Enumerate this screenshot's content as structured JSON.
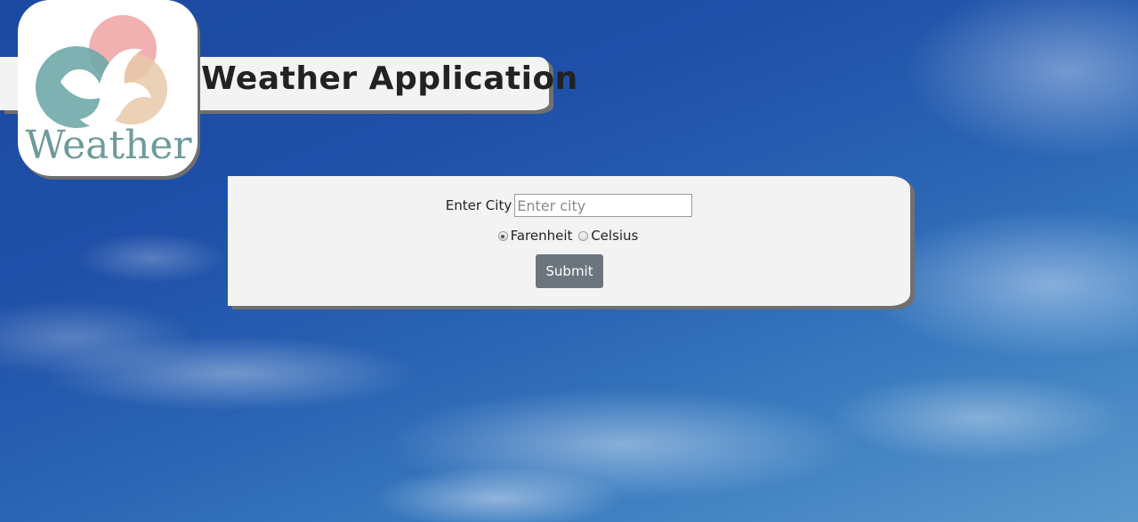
{
  "app": {
    "title": "Weather Application",
    "logo_text": "Weather"
  },
  "form": {
    "city_label": "Enter City",
    "city_value": "",
    "city_placeholder": "Enter city",
    "units": [
      {
        "label": "Farenheit",
        "checked": true
      },
      {
        "label": "Celsius",
        "checked": false
      }
    ],
    "submit_label": "Submit"
  },
  "colors": {
    "logo_pink": "#f0a8a8",
    "logo_peach": "#e8c9a8",
    "logo_teal": "#6fa8aa",
    "logo_text": "#6f9a9b",
    "button": "#6c757d"
  }
}
